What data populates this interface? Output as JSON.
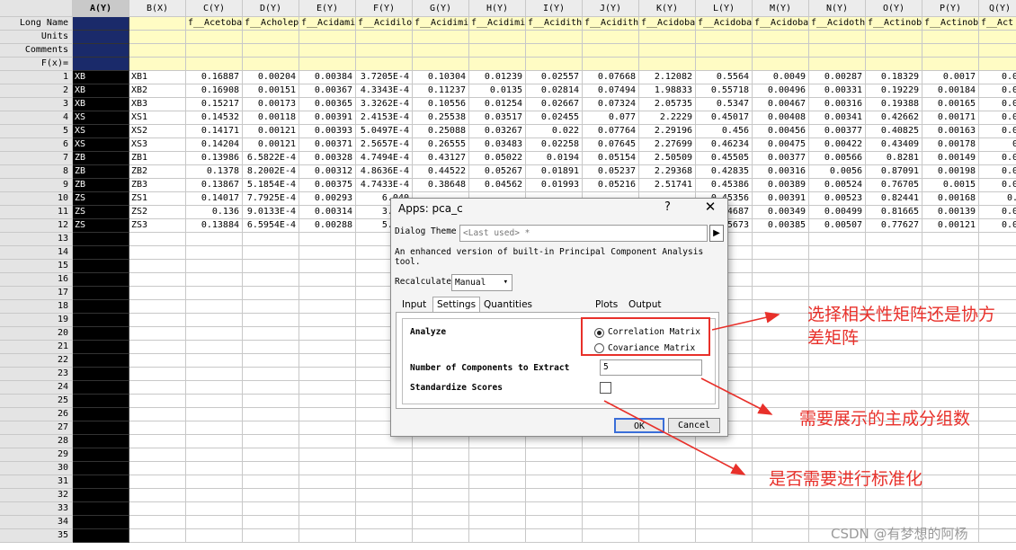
{
  "columns": [
    {
      "header": "A(Y)",
      "long_name": "",
      "kind": "text"
    },
    {
      "header": "B(X)",
      "long_name": "",
      "kind": "text"
    },
    {
      "header": "C(Y)",
      "long_name": "f__Acetoba"
    },
    {
      "header": "D(Y)",
      "long_name": "f__Acholep"
    },
    {
      "header": "E(Y)",
      "long_name": "f__Acidami"
    },
    {
      "header": "F(Y)",
      "long_name": "f__Acidilo"
    },
    {
      "header": "G(Y)",
      "long_name": "f__Acidimi"
    },
    {
      "header": "H(Y)",
      "long_name": "f__Acidimi"
    },
    {
      "header": "I(Y)",
      "long_name": "f__Acidith"
    },
    {
      "header": "J(Y)",
      "long_name": "f__Acidith"
    },
    {
      "header": "K(Y)",
      "long_name": "f__Acidoba"
    },
    {
      "header": "L(Y)",
      "long_name": "f__Acidoba"
    },
    {
      "header": "M(Y)",
      "long_name": "f__Acidoba"
    },
    {
      "header": "N(Y)",
      "long_name": "f__Acidoth"
    },
    {
      "header": "O(Y)",
      "long_name": "f__Actinob"
    },
    {
      "header": "P(Y)",
      "long_name": "f__Actinob"
    },
    {
      "header": "Q(Y)",
      "long_name": "f__Act"
    }
  ],
  "meta_rows": [
    "Long Name",
    "Units",
    "Comments",
    "F(x)="
  ],
  "rows": [
    [
      "XB",
      "XB1",
      "0.16887",
      "0.00204",
      "0.00384",
      "3.7205E-4",
      "0.10304",
      "0.01239",
      "0.02557",
      "0.07668",
      "2.12082",
      "0.5564",
      "0.0049",
      "0.00287",
      "0.18329",
      "0.0017",
      "0.0"
    ],
    [
      "XB",
      "XB2",
      "0.16908",
      "0.00151",
      "0.00367",
      "4.3343E-4",
      "0.11237",
      "0.0135",
      "0.02814",
      "0.07494",
      "1.98833",
      "0.55718",
      "0.00496",
      "0.00331",
      "0.19229",
      "0.00184",
      "0.0"
    ],
    [
      "XB",
      "XB3",
      "0.15217",
      "0.00173",
      "0.00365",
      "3.3262E-4",
      "0.10556",
      "0.01254",
      "0.02667",
      "0.07324",
      "2.05735",
      "0.5347",
      "0.00467",
      "0.00316",
      "0.19388",
      "0.00165",
      "0.0"
    ],
    [
      "XS",
      "XS1",
      "0.14532",
      "0.00118",
      "0.00391",
      "2.4153E-4",
      "0.25538",
      "0.03517",
      "0.02455",
      "0.077",
      "2.2229",
      "0.45017",
      "0.00408",
      "0.00341",
      "0.42662",
      "0.00171",
      "0.0"
    ],
    [
      "XS",
      "XS2",
      "0.14171",
      "0.00121",
      "0.00393",
      "5.0497E-4",
      "0.25088",
      "0.03267",
      "0.022",
      "0.07764",
      "2.29196",
      "0.456",
      "0.00456",
      "0.00377",
      "0.40825",
      "0.00163",
      "0.0"
    ],
    [
      "XS",
      "XS3",
      "0.14204",
      "0.00121",
      "0.00371",
      "2.5657E-4",
      "0.26555",
      "0.03483",
      "0.02258",
      "0.07645",
      "2.27699",
      "0.46234",
      "0.00475",
      "0.00422",
      "0.43409",
      "0.00178",
      "0"
    ],
    [
      "ZB",
      "ZB1",
      "0.13986",
      "6.5822E-4",
      "0.00328",
      "4.7494E-4",
      "0.43127",
      "0.05022",
      "0.0194",
      "0.05154",
      "2.50509",
      "0.45505",
      "0.00377",
      "0.00566",
      "0.8281",
      "0.00149",
      "0.0"
    ],
    [
      "ZB",
      "ZB2",
      "0.1378",
      "8.2002E-4",
      "0.00312",
      "4.8636E-4",
      "0.44522",
      "0.05267",
      "0.01891",
      "0.05237",
      "2.29368",
      "0.42835",
      "0.00316",
      "0.0056",
      "0.87091",
      "0.00198",
      "0.0"
    ],
    [
      "ZB",
      "ZB3",
      "0.13867",
      "5.1854E-4",
      "0.00375",
      "4.7433E-4",
      "0.38648",
      "0.04562",
      "0.01993",
      "0.05216",
      "2.51741",
      "0.45386",
      "0.00389",
      "0.00524",
      "0.76705",
      "0.0015",
      "0.0"
    ],
    [
      "ZS",
      "ZS1",
      "0.14017",
      "7.7925E-4",
      "0.00293",
      "6.040",
      "",
      "",
      "",
      "",
      "",
      "0.45356",
      "0.00391",
      "0.00523",
      "0.82441",
      "0.00168",
      "0."
    ],
    [
      "ZS",
      "ZS2",
      "0.136",
      "9.0133E-4",
      "0.00314",
      "3.923",
      "",
      "",
      "",
      "",
      "",
      "0.44687",
      "0.00349",
      "0.00499",
      "0.81665",
      "0.00139",
      "0.0"
    ],
    [
      "ZS",
      "ZS3",
      "0.13884",
      "6.5954E-4",
      "0.00288",
      "5.319",
      "",
      "",
      "",
      "",
      "",
      "0.45673",
      "0.00385",
      "0.00507",
      "0.77627",
      "0.00121",
      "0.0"
    ]
  ],
  "row_numbers": [
    "1",
    "2",
    "3",
    "4",
    "5",
    "6",
    "7",
    "8",
    "9",
    "10",
    "11",
    "12",
    "13",
    "14",
    "15",
    "16",
    "17",
    "18",
    "19",
    "20",
    "21",
    "22",
    "23",
    "24",
    "25",
    "26",
    "27",
    "28",
    "29",
    "30",
    "31",
    "32",
    "33",
    "34",
    "35"
  ],
  "dialog": {
    "title": "Apps: pca_c",
    "help": "?",
    "close": "✕",
    "theme_label": "Dialog Theme",
    "theme_value": "<Last used> *",
    "description": "An enhanced version of built-in Principal Component Analysis tool.",
    "recalc_label": "Recalculate",
    "recalc_value": "Manual",
    "tabs": [
      "Input",
      "Settings",
      "Quantities to Compute",
      "Plots",
      "Output"
    ],
    "active_tab": "Settings",
    "analyze_label": "Analyze",
    "option_correlation": "Correlation Matrix",
    "option_covariance": "Covariance Matrix",
    "components_label": "Number of Components to Extract",
    "components_value": "5",
    "standardize_label": "Standardize Scores",
    "ok": "OK",
    "cancel": "Cancel"
  },
  "annotations": {
    "matrix_choice": "选择相关性矩阵还是协方差矩阵",
    "components_note": "需要展示的主成分组数",
    "standardize_note": "是否需要进行标准化"
  },
  "watermark": "CSDN @有梦想的阿杨",
  "colors": {
    "annotation": "#e8302a",
    "meta_row_bg": "#fffcc4",
    "selected_column": "#000000"
  }
}
